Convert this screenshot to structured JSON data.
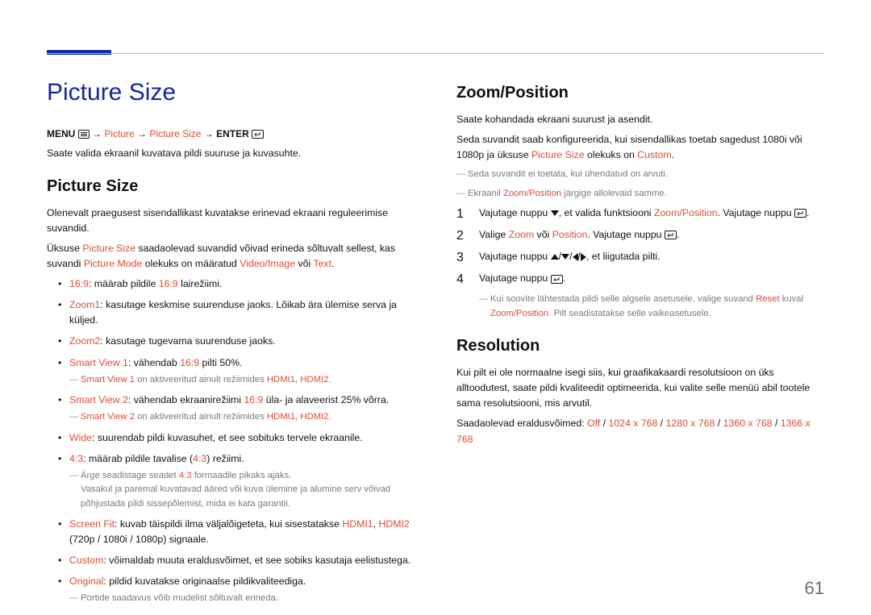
{
  "pageNumber": "61",
  "left": {
    "title": "Picture Size",
    "menupath": {
      "menu": "MENU",
      "picture": "Picture",
      "picturesize": "Picture Size",
      "enter": "ENTER"
    },
    "intro": "Saate valida ekraanil kuvatava pildi suuruse ja kuvasuhte.",
    "sub1": "Picture Size",
    "para1": "Olenevalt praegusest sisendallikast kuvatakse erinevad ekraani reguleerimise suvandid.",
    "para2a": "Üksuse ",
    "para2b": "Picture Size",
    "para2c": " saadaolevad suvandid võivad erineda sõltuvalt sellest, kas suvandi ",
    "para2d": "Picture Mode",
    "para2e": " olekuks on määratud ",
    "para2f": "Video/Image",
    "para2g": " või ",
    "para2h": "Text",
    "para2i": ".",
    "items": [
      {
        "hl": "16:9",
        "txt_a": ": määrab pildile ",
        "hl2": "16:9",
        "txt_b": " lairežiimi."
      },
      {
        "hl": "Zoom1",
        "txt_a": ": kasutage keskmise suurenduse jaoks. Lõikab ära ülemise serva ja küljed."
      },
      {
        "hl": "Zoom2",
        "txt_a": ": kasutage tugevama suurenduse jaoks."
      },
      {
        "hl": "Smart View 1",
        "txt_a": ": vähendab ",
        "hl2": "16:9",
        "txt_b": " pilti 50%.",
        "dash_a": "Smart View 1",
        "dash_b": " on aktiveeritud ainult režiimides ",
        "dash_c": "HDMI1",
        "dash_d": ", ",
        "dash_e": "HDMI2",
        "dash_f": "."
      },
      {
        "hl": "Smart View 2",
        "txt_a": ": vähendab ekraanirežiimi ",
        "hl2": "16:9",
        "txt_b": " üla- ja alaveerist 25% võrra.",
        "dash_a": "Smart View 2",
        "dash_b": " on aktiveeritud ainult režiimides ",
        "dash_c": "HDMI1",
        "dash_d": ", ",
        "dash_e": "HDMI2",
        "dash_f": "."
      },
      {
        "hl": "Wide",
        "txt_a": ": suurendab pildi kuvasuhet, et see sobituks tervele ekraanile."
      },
      {
        "hl": "4:3",
        "txt_a": ": määrab pildile tavalise (",
        "hl2": "4:3",
        "txt_b": ") režiimi.",
        "dash_plain_a": "Ärge seadistage seadet ",
        "dash_hl": "4:3",
        "dash_plain_b": " formaadile pikaks ajaks.",
        "dash_extra": "Vasakul ja paremal kuvatavad ääred või kuva ülemine ja alumine serv võivad põhjustada pildi sissepõlemist, mida ei kata garantii."
      },
      {
        "hl": "Screen Fit",
        "txt_a": ": kuvab täispildi ilma väljalõigeteta, kui sisestatakse ",
        "hl2": "HDMI1",
        "txt_comma": ", ",
        "hl3": "HDMI2",
        "txt_b": " (720p / 1080i / 1080p) signaale."
      },
      {
        "hl": "Custom",
        "txt_a": ": võimaldab muuta eraldusvõimet, et see sobiks kasutaja eelistustega."
      },
      {
        "hl": "Original",
        "txt_a": ": pildid kuvatakse originaalse pildikvaliteediga.",
        "dash_plain": "Portide saadavus võib mudelist sõltuvalt erineda."
      }
    ]
  },
  "right": {
    "zoom_title": "Zoom/Position",
    "zoom_intro": "Saate kohandada ekraani suurust ja asendit.",
    "zoom_para_a": "Seda suvandit saab konfigureerida, kui sisendallikas toetab sagedust 1080i või 1080p ja üksuse ",
    "zoom_para_b": "Picture Size",
    "zoom_para_c": " olekuks on ",
    "zoom_para_d": "Custom",
    "zoom_para_e": ".",
    "zoom_dash1": "Seda suvandit ei toetata, kui ühendatud on arvuti.",
    "zoom_dash2_a": "Ekraanil ",
    "zoom_dash2_b": "Zoom/Position",
    "zoom_dash2_c": " järgige allolevaid samme.",
    "steps": [
      {
        "a": "Vajutage nuppu ",
        "b": ", et valida funktsiooni ",
        "c": "Zoom/Position",
        "d": ". Vajutage nuppu "
      },
      {
        "a": "Valige ",
        "b": "Zoom",
        "c": " või ",
        "d": "Position",
        "e": ". Vajutage nuppu "
      },
      {
        "a": "Vajutage nuppu ",
        "b": ", et liigutada pilti."
      },
      {
        "a": "Vajutage nuppu "
      }
    ],
    "reset_a": "Kui soovite lähtestada pildi selle algsele asetusele, valige suvand ",
    "reset_b": "Reset",
    "reset_c": " kuval ",
    "reset_d": "Zoom/Position",
    "reset_e": ". Pilt seadistatakse selle vaikeasetusele.",
    "res_title": "Resolution",
    "res_para": "Kui pilt ei ole normaalne isegi siis, kui graafikakaardi resolutsioon on üks alltoodutest, saate pildi kvaliteedit optimeerida, kui valite selle menüü abil tootele sama resolutsiooni, mis arvutil.",
    "res_list_a": "Saadaolevad eraldusvõimed: ",
    "res_opts": [
      "Off",
      "1024 x 768",
      "1280 x 768",
      "1360 x 768",
      "1366 x 768"
    ],
    "sep": " / "
  }
}
